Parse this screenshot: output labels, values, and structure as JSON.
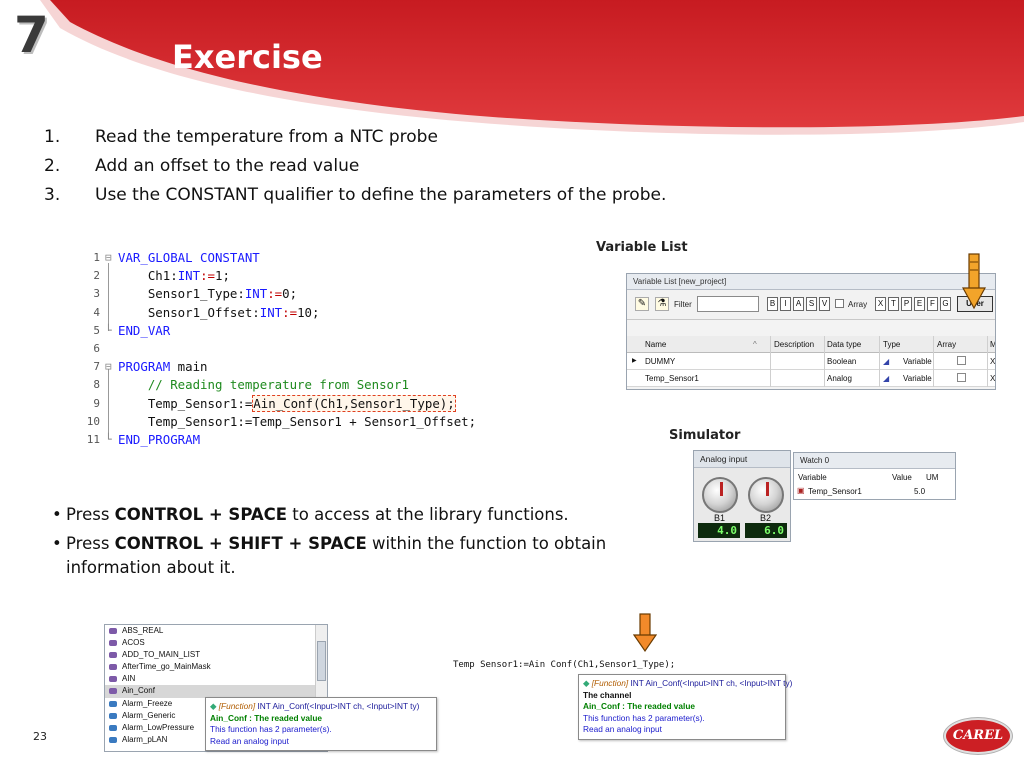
{
  "slide": {
    "number_big": "7",
    "title": "Exercise",
    "page": "23",
    "logo_text": "CAREL",
    "accent_color": "#d7242a"
  },
  "steps": [
    {
      "num": "1.",
      "text": "Read the temperature from a NTC probe"
    },
    {
      "num": "2.",
      "text": "Add an offset to the read value"
    },
    {
      "num": "3.",
      "text": "Use the CONSTANT qualifier to define the parameters of the probe."
    }
  ],
  "code": {
    "line_numbers": [
      "1",
      "2",
      "3",
      "4",
      "5",
      "6",
      "7",
      "8",
      "9",
      "10",
      "11"
    ],
    "l1_kw": "VAR_GLOBAL CONSTANT",
    "l2_a": "Ch1:",
    "l2_type": "INT",
    "l2_op": ":=",
    "l2_b": "1;",
    "l3_a": "Sensor1_Type:",
    "l3_type": "INT",
    "l3_op": ":=",
    "l3_b": "0;",
    "l4_a": "Sensor1_Offset:",
    "l4_type": "INT",
    "l4_op": ":=",
    "l4_b": "10;",
    "l5_kw": "END_VAR",
    "l7_kw": "PROGRAM",
    "l7_b": " main",
    "l8_comment": "// Reading temperature from Sensor1",
    "l9_a": "Temp_Sensor1:=",
    "l9_hl": "Ain_Conf(Ch1,Sensor1_Type);",
    "l10": "Temp_Sensor1:=Temp_Sensor1 + Sensor1_Offset;",
    "l11_kw": "END_PROGRAM"
  },
  "variable_list": {
    "label": "Variable List",
    "window_title": "Variable List [new_project]",
    "filter_label": "Filter",
    "filter_value": "",
    "filter_letters_1": [
      "B",
      "I",
      "A",
      "S",
      "V"
    ],
    "array_label": "Array",
    "filter_letters_2": [
      "X",
      "T",
      "P",
      "E",
      "F",
      "G"
    ],
    "user_button": "User",
    "columns": [
      "Name",
      "Description",
      "Data type",
      "Type",
      "Array",
      "M"
    ],
    "rows": [
      {
        "name": "DUMMY",
        "description": "",
        "data_type": "Boolean",
        "type": "Variable",
        "m": "X"
      },
      {
        "name": "Temp_Sensor1",
        "description": "",
        "data_type": "Analog",
        "type": "Variable",
        "m": "X"
      }
    ]
  },
  "simulator": {
    "label": "Simulator",
    "analog_title": "Analog input",
    "knob1_label": "B1",
    "knob1_value": "4.0",
    "knob2_label": "B2",
    "knob2_value": "6.0",
    "watch_title": "Watch 0",
    "watch_columns": [
      "Variable",
      "Value",
      "UM"
    ],
    "watch_row": {
      "variable": "Temp_Sensor1",
      "value": "5.0"
    }
  },
  "tips": [
    {
      "pre": "Press ",
      "key": "CONTROL + SPACE",
      "post": " to access at the library functions."
    },
    {
      "pre": "Press ",
      "key": "CONTROL + SHIFT + SPACE",
      "post": " within the function to obtain information about it."
    }
  ],
  "autocomplete": {
    "items": [
      "ABS_REAL",
      "ACOS",
      "ADD_TO_MAIN_LIST",
      "AfterTime_go_MainMask",
      "AIN",
      "Ain_Conf",
      "Alarm_Freeze",
      "Alarm_Generic",
      "Alarm_LowPressure",
      "Alarm_pLAN"
    ],
    "selected_index": 5
  },
  "tooltip_left": {
    "fn_tag": "[Function]",
    "signature_type": " INT ",
    "signature_name": "Ain_Conf(",
    "sig_in1": "<Input>",
    "sig_mid1": "INT ch, ",
    "sig_in2": "<Input>",
    "sig_end": "INT ty)",
    "result": "Ain_Conf : The readed value",
    "params": "This function has 2 parameter(s).",
    "desc": "Read an analog input"
  },
  "code_line2": "Temp Sensor1:=Ain Conf(Ch1,Sensor1_Type);",
  "tooltip_right": {
    "fn_tag": "[Function]",
    "signature_type": " INT ",
    "signature_name": "Ain_Conf(",
    "sig_in1": "<Input>",
    "sig_mid1": "INT ch, ",
    "sig_in2": "<Input>",
    "sig_end": "INT ty)",
    "channel": "The channel",
    "result": "Ain_Conf : The readed value",
    "params": "This function has 2 parameter(s).",
    "desc": "Read an analog input"
  }
}
